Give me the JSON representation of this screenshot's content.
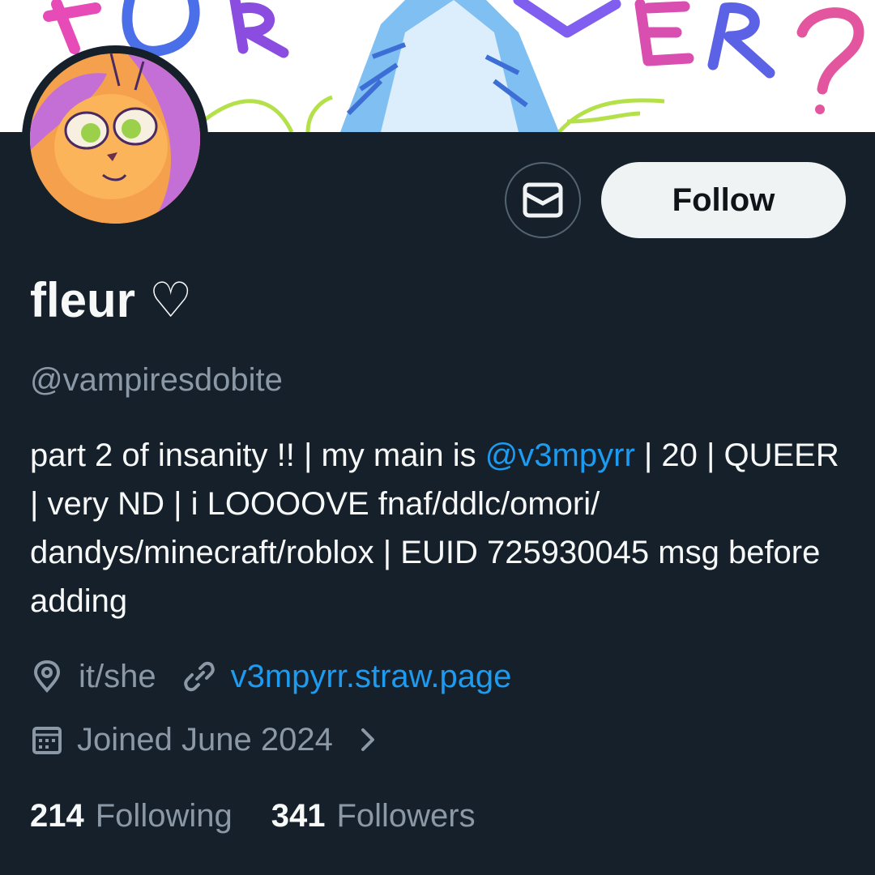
{
  "header": {
    "banner_text": "FOREVER?"
  },
  "profile": {
    "display_name": "fleur ♡",
    "handle": "@vampiresdobite",
    "bio": {
      "part1": "part 2 of insanity !! | my main is ",
      "mention": "@v3mpyrr",
      "part2": " | 20 | QUEER | very ND | i LOOOOVE fnaf/ddlc/omori/ dandys/minecraft/roblox | EUID 725930045 msg before adding"
    },
    "location": "it/she",
    "website": "v3mpyrr.straw.page",
    "joined": "Joined June 2024",
    "following_count": "214",
    "following_label": "Following",
    "followers_count": "341",
    "followers_label": "Followers"
  },
  "actions": {
    "follow_label": "Follow",
    "message_icon": "envelope-icon"
  },
  "colors": {
    "background": "#15202b",
    "accent": "#1d9bf0",
    "muted_text": "#8b98a5",
    "primary_text": "#f7f9f9"
  }
}
